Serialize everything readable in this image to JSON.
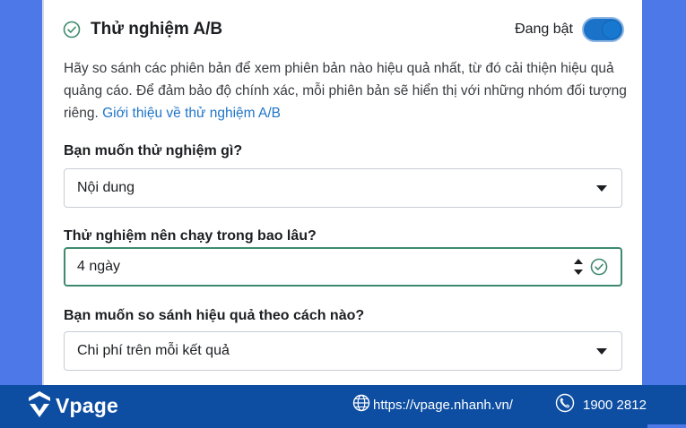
{
  "section": {
    "title": "Thử nghiệm A/B",
    "toggle_label": "Đang bật",
    "toggle_on": true,
    "description": "Hãy so sánh các phiên bản để xem phiên bản nào hiệu quả nhất, từ đó cải thiện hiệu quả quảng cáo. Để đảm bảo độ chính xác, mỗi phiên bản sẽ hiển thị với những nhóm đối tượng riêng.",
    "link_text": "Giới thiệu về thử nghiệm A/B"
  },
  "fields": {
    "test_what": {
      "label": "Bạn muốn thử nghiệm gì?",
      "value": "Nội dung"
    },
    "duration": {
      "label": "Thử nghiệm nên chạy trong bao lâu?",
      "value": "4 ngày"
    },
    "compare": {
      "label": "Bạn muốn so sánh hiệu quả theo cách nào?",
      "value": "Chi phí trên mỗi kết quả"
    }
  },
  "footer": {
    "brand": "Vpage",
    "website": "https://vpage.nhanh.vn/",
    "phone": "1900 2812"
  },
  "colors": {
    "accent_blue": "#1a73c9",
    "link": "#2176c9",
    "success_green": "#3e8a6e",
    "footer_bg": "#0d4ea2",
    "page_bg": "#4d78e8"
  }
}
